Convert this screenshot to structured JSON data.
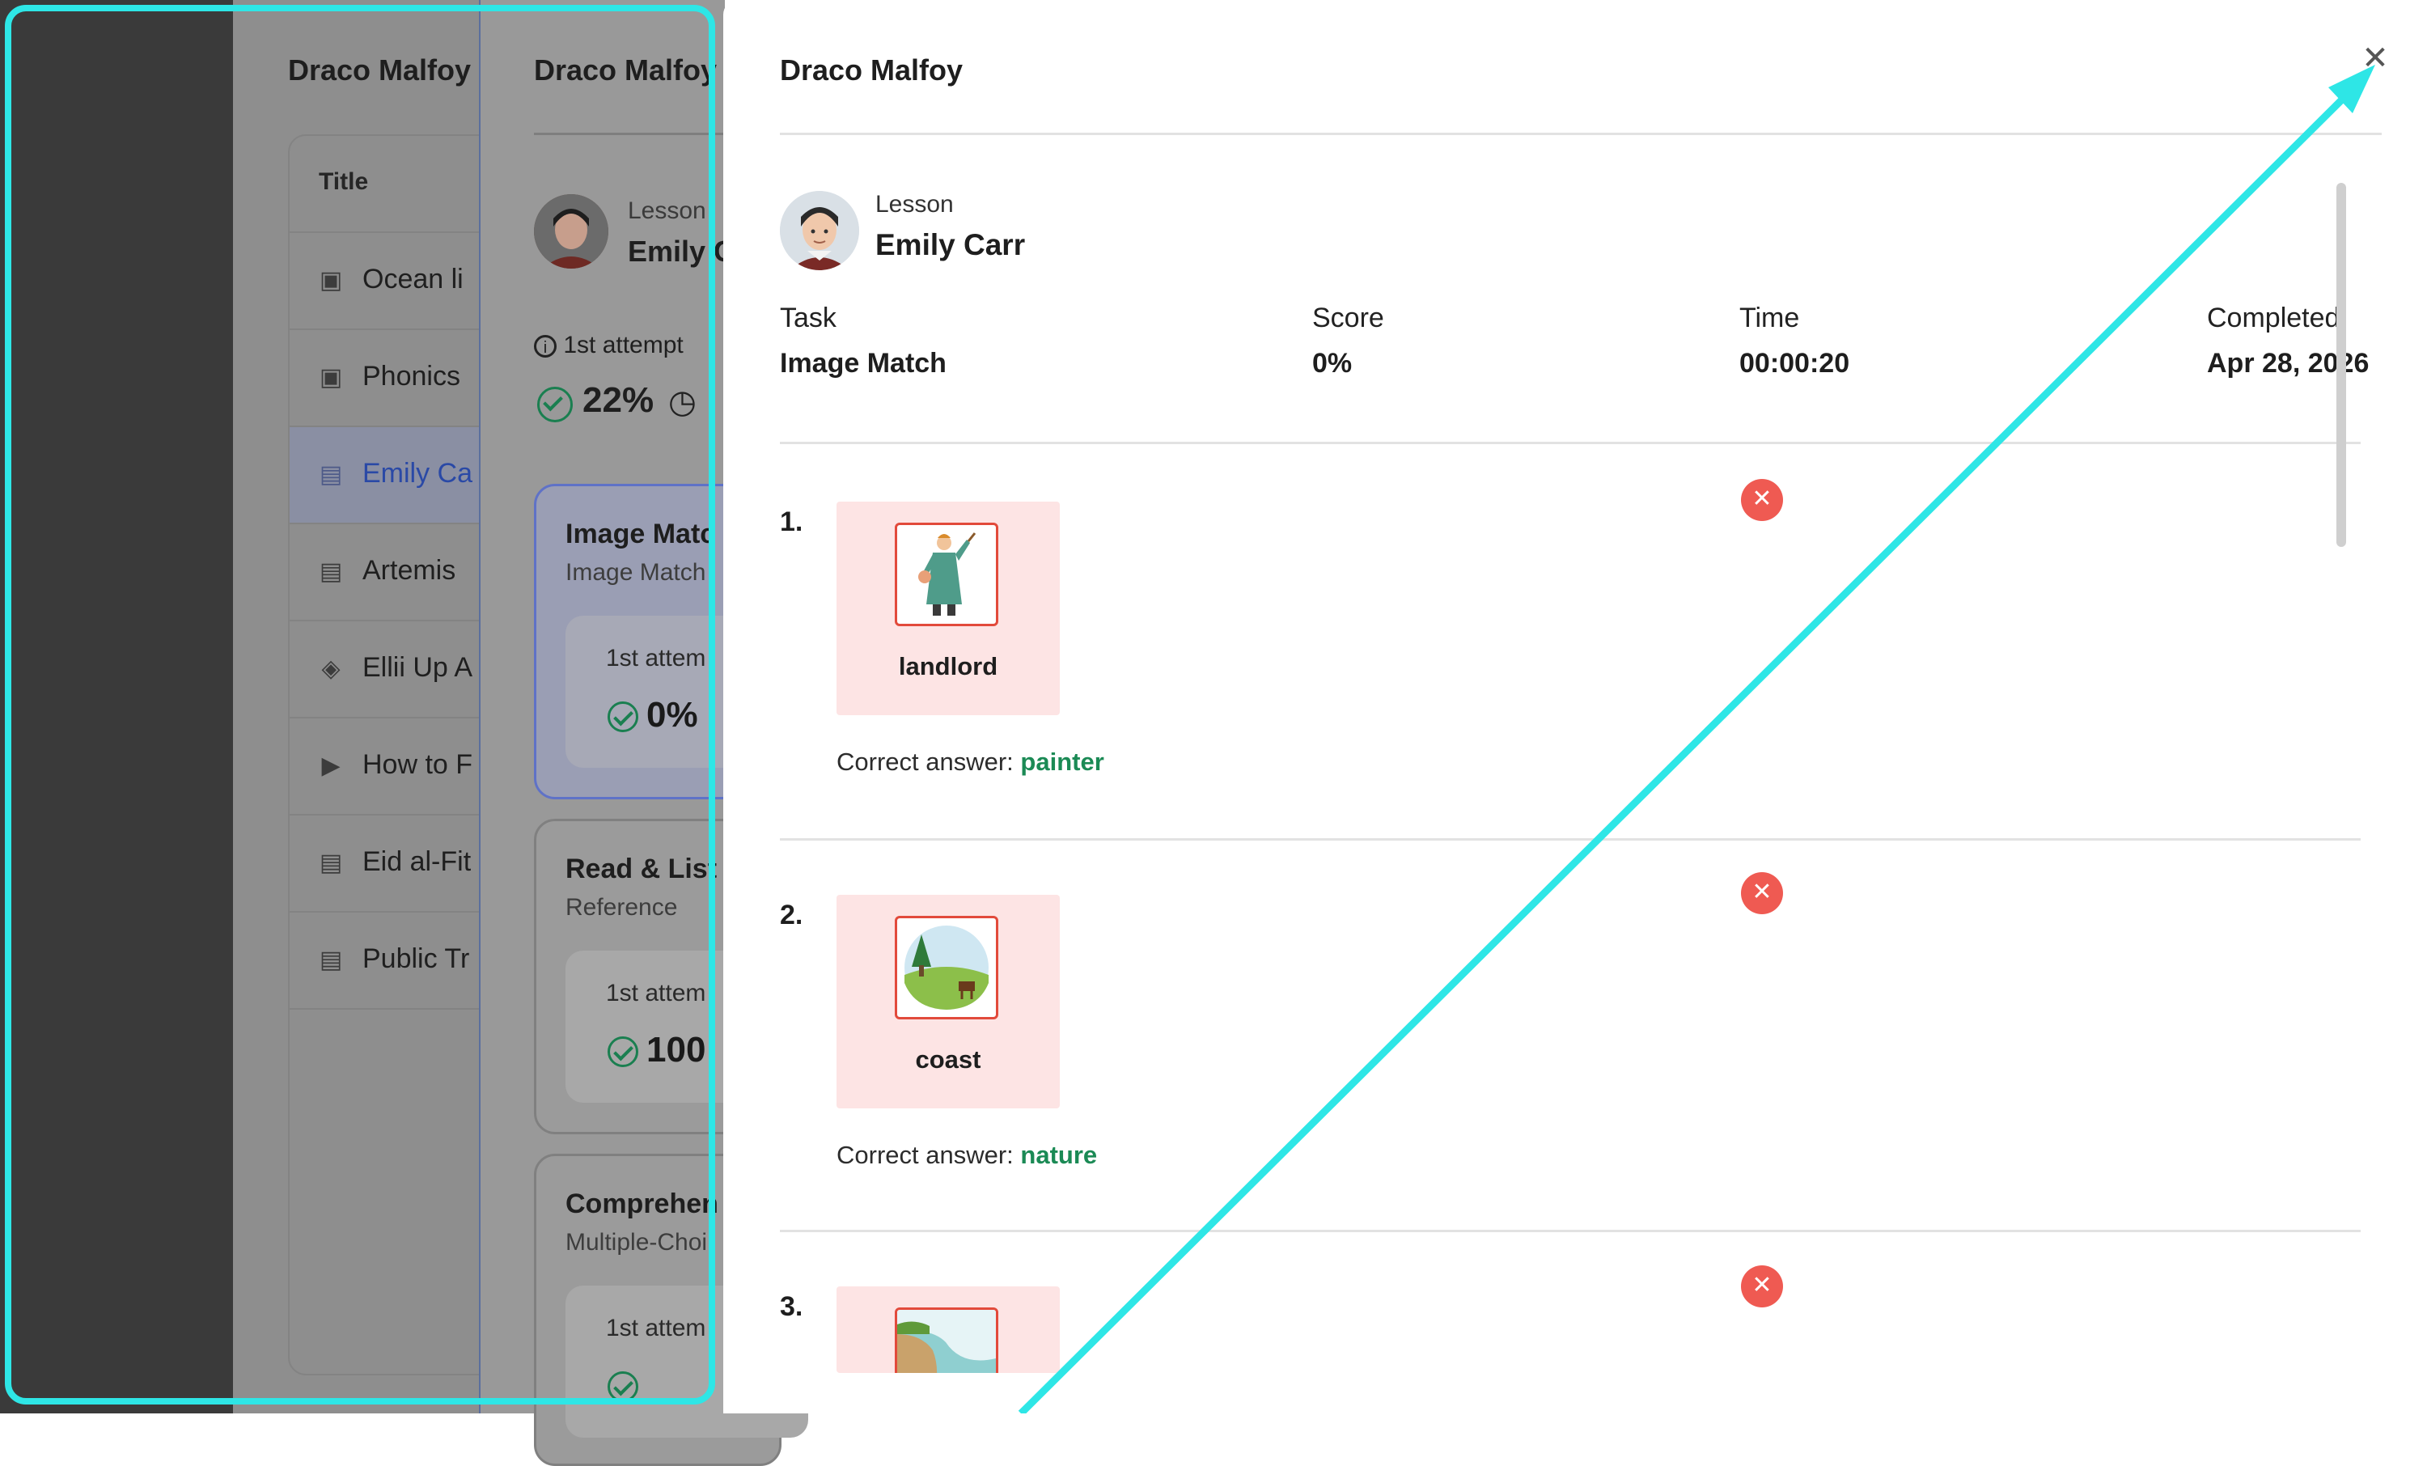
{
  "background": {
    "panel1": {
      "title": "Draco Malfoy",
      "column_header": "Title",
      "items": [
        {
          "label": "Ocean li",
          "icon": "image-doc-icon"
        },
        {
          "label": "Phonics",
          "icon": "image-doc-icon"
        },
        {
          "label": "Emily Ca",
          "icon": "document-icon",
          "active": true
        },
        {
          "label": "Artemis",
          "icon": "document-icon"
        },
        {
          "label": "Ellii Up A",
          "icon": "graduation-cap-icon"
        },
        {
          "label": "How to F",
          "icon": "video-icon"
        },
        {
          "label": "Eid al-Fit",
          "icon": "document-icon"
        },
        {
          "label": "Public Tr",
          "icon": "document-icon"
        }
      ]
    },
    "panel2": {
      "title": "Draco Malfoy",
      "lesson_label": "Lesson",
      "lesson_name": "Emily C",
      "attempt": "1st attempt",
      "score": "22%",
      "tasks": [
        {
          "title": "Image Matc",
          "subtitle": "Image Match",
          "attempt": "1st attem",
          "score": "0%",
          "selected": true
        },
        {
          "title": "Read & List",
          "subtitle": "Reference",
          "attempt": "1st attem",
          "score": "100"
        },
        {
          "title": "Comprehen",
          "subtitle": "Multiple-Choi",
          "attempt": "1st attem",
          "score": ""
        }
      ]
    }
  },
  "drawer": {
    "title": "Draco Malfoy",
    "close_icon": "close-icon",
    "lesson_label": "Lesson",
    "lesson_name": "Emily Carr",
    "meta": {
      "task_label": "Task",
      "task_value": "Image Match",
      "score_label": "Score",
      "score_value": "0%",
      "time_label": "Time",
      "time_value": "00:00:20",
      "completed_label": "Completed",
      "completed_value": "Apr 28, 2026"
    },
    "correct_prefix": "Correct answer:",
    "questions": [
      {
        "number": "1.",
        "word": "landlord",
        "correct": "painter",
        "image": "landlord-picture"
      },
      {
        "number": "2.",
        "word": "coast",
        "correct": "nature",
        "image": "landscape-picture"
      },
      {
        "number": "3.",
        "word": "",
        "correct": "",
        "image": "coast-picture"
      }
    ]
  },
  "colors": {
    "highlight": "#2ee6e6",
    "wrong": "#ef5a52",
    "correct_text": "#1b8a55",
    "card_bg": "#fde4e4"
  }
}
